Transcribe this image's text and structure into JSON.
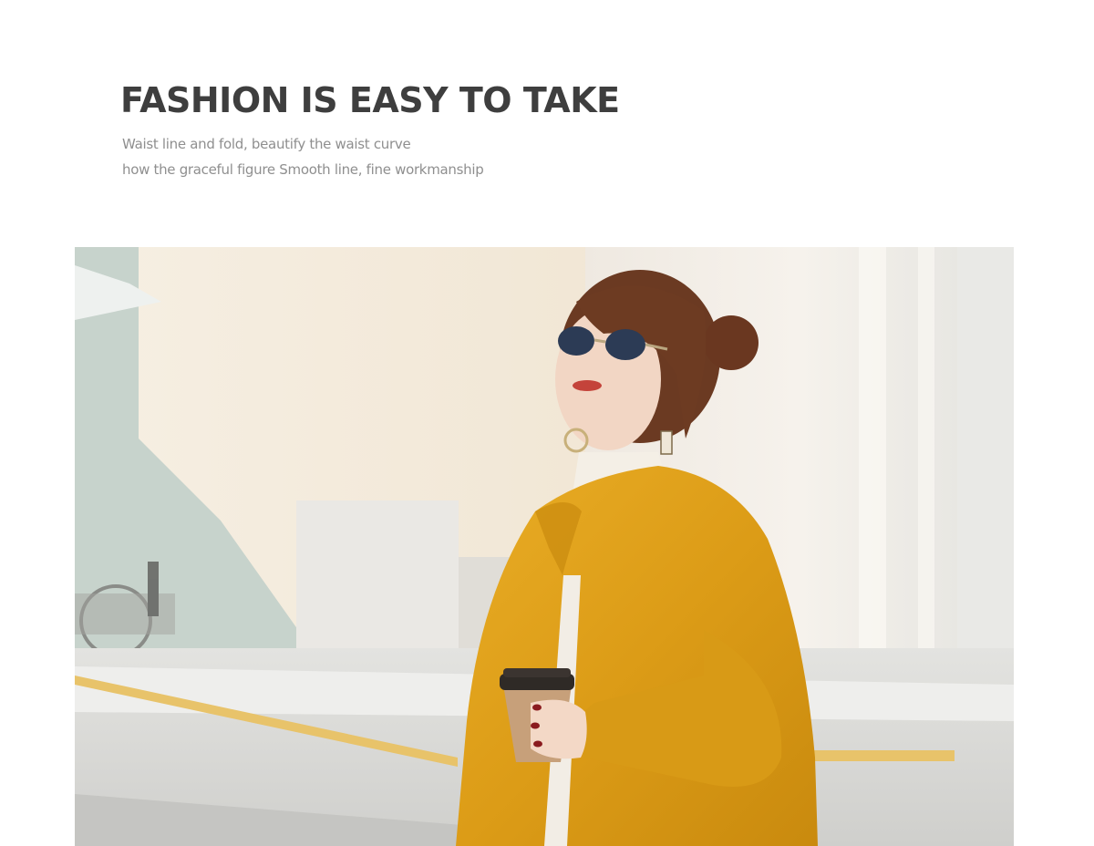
{
  "header": {
    "headline": "FASHION IS EASY TO TAKE",
    "subline_1": "Waist line and fold, beautify the waist curve",
    "subline_2": "how the graceful figure  Smooth line, fine workmanship"
  },
  "photo": {
    "subject": "woman-in-mustard-faux-fur-coat-holding-coffee-cup",
    "colors": {
      "coat": "#e0a21a",
      "wall": "#f3eadc",
      "sky_wall": "#c9d6cf",
      "ground": "#d8d8d6"
    }
  }
}
